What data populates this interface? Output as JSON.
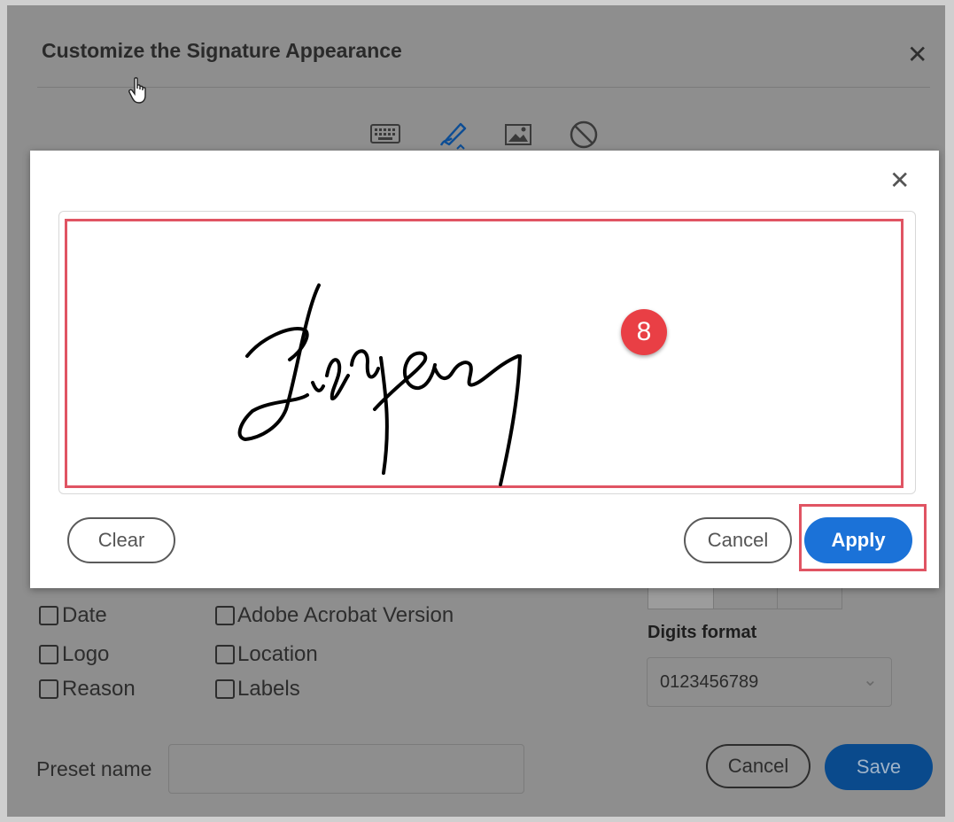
{
  "dialog": {
    "title": "Customize the Signature Appearance",
    "close_icon": "close-icon",
    "mode_icons": [
      "keyboard-icon",
      "draw-pen-icon",
      "image-icon",
      "none-icon"
    ]
  },
  "options": {
    "col1": [
      "Date",
      "Logo",
      "Reason"
    ],
    "col2": [
      "Adobe Acrobat Version",
      "Location",
      "Labels"
    ]
  },
  "digits": {
    "label": "Digits format",
    "value": "0123456789"
  },
  "preset": {
    "label": "Preset name",
    "value": ""
  },
  "footer": {
    "cancel_label": "Cancel",
    "save_label": "Save"
  },
  "draw_modal": {
    "step_number": "8",
    "clear_label": "Clear",
    "cancel_label": "Cancel",
    "apply_label": "Apply",
    "highlight_color": "#e05463",
    "apply_color": "#1b72d8"
  }
}
